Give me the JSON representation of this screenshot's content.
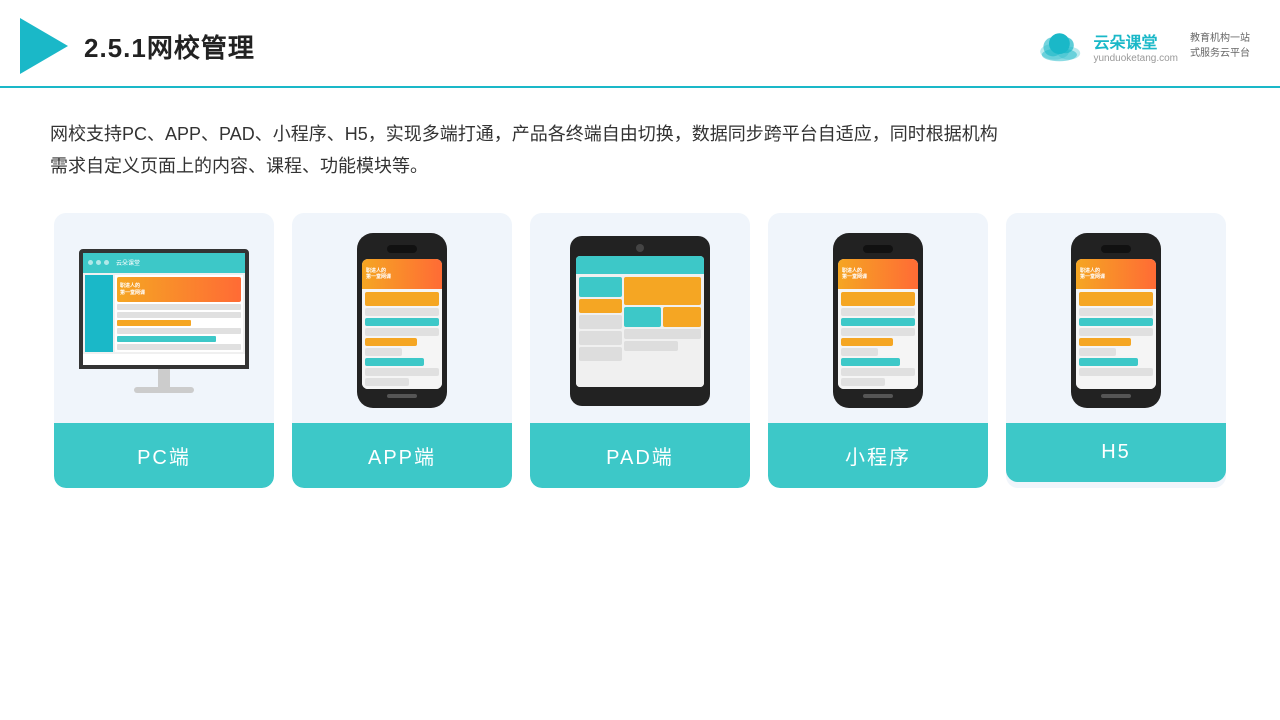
{
  "header": {
    "title": "2.5.1网校管理",
    "brand": {
      "name": "云朵课堂",
      "url": "yunduoketang.com",
      "slogan": "教育机构一站\n式服务云平台"
    }
  },
  "description": "网校支持PC、APP、PAD、小程序、H5，实现多端打通，产品各终端自由切换，数据同步跨平台自适应，同时根据机构\n需求自定义页面上的内容、课程、功能模块等。",
  "cards": [
    {
      "id": "pc",
      "label": "PC端"
    },
    {
      "id": "app",
      "label": "APP端"
    },
    {
      "id": "pad",
      "label": "PAD端"
    },
    {
      "id": "miniprogram",
      "label": "小程序"
    },
    {
      "id": "h5",
      "label": "H5"
    }
  ],
  "colors": {
    "teal": "#3dc8c8",
    "orange": "#f5a623",
    "dark": "#222",
    "light_bg": "#f0f5fb"
  }
}
